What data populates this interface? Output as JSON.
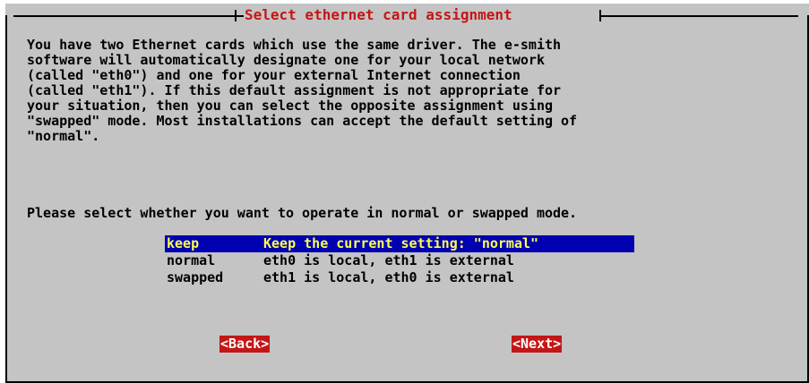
{
  "dialog": {
    "title": "Select ethernet card assignment",
    "description": "You have two Ethernet cards which use the same driver. The e-smith\nsoftware will automatically designate one for your local network\n(called \"eth0\") and one for your external Internet connection\n(called \"eth1\"). If this default assignment is not appropriate for\nyour situation, then you can select the opposite assignment using\n\"swapped\" mode. Most installations can accept the default setting of\n\"normal\".",
    "prompt": "Please select whether you want to operate in normal or swapped mode.",
    "options": [
      {
        "key": "keep",
        "description": "Keep the current setting: \"normal\"",
        "selected": true
      },
      {
        "key": "normal",
        "description": "eth0 is local, eth1 is external",
        "selected": false
      },
      {
        "key": "swapped",
        "description": "eth1 is local, eth0 is external",
        "selected": false
      }
    ],
    "buttons": {
      "back_label": "<Back>",
      "next_label": "<Next>"
    }
  },
  "colors": {
    "background": "#c4c4c4",
    "title": "#c41616",
    "selection_bg": "#0000b0",
    "selection_fg": "#ffff55",
    "button_bg": "#c41616",
    "button_fg": "#ffffff"
  }
}
